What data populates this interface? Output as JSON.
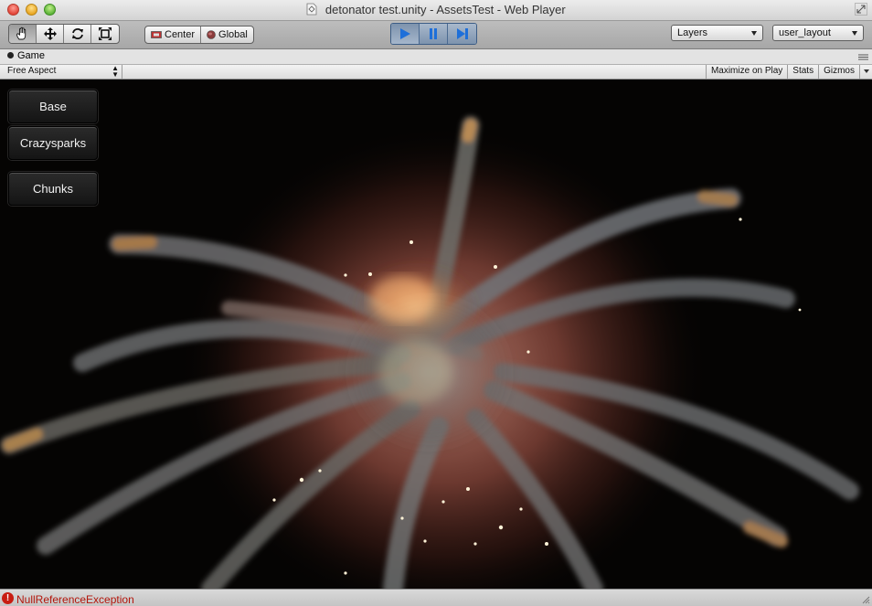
{
  "window": {
    "title": "detonator test.unity - AssetsTest - Web Player"
  },
  "toolbar": {
    "transform_tools": [
      "hand-icon",
      "move-icon",
      "rotate-icon",
      "scale-icon"
    ],
    "pivot_label": "Center",
    "space_label": "Global",
    "playback": [
      "play-icon",
      "pause-icon",
      "step-icon"
    ],
    "layers_label": "Layers",
    "layout_label": "user_layout"
  },
  "game_tab": {
    "title": "Game",
    "aspect": "Free Aspect",
    "maximize_label": "Maximize on Play",
    "stats_label": "Stats",
    "gizmos_label": "Gizmos"
  },
  "game_buttons": [
    "Base",
    "Crazysparks",
    "Chunks"
  ],
  "status": {
    "message": "NullReferenceException"
  },
  "colors": {
    "play_accent": "#1e6fd9",
    "error_red": "#c81d12",
    "viewport_bg": "#050403"
  }
}
